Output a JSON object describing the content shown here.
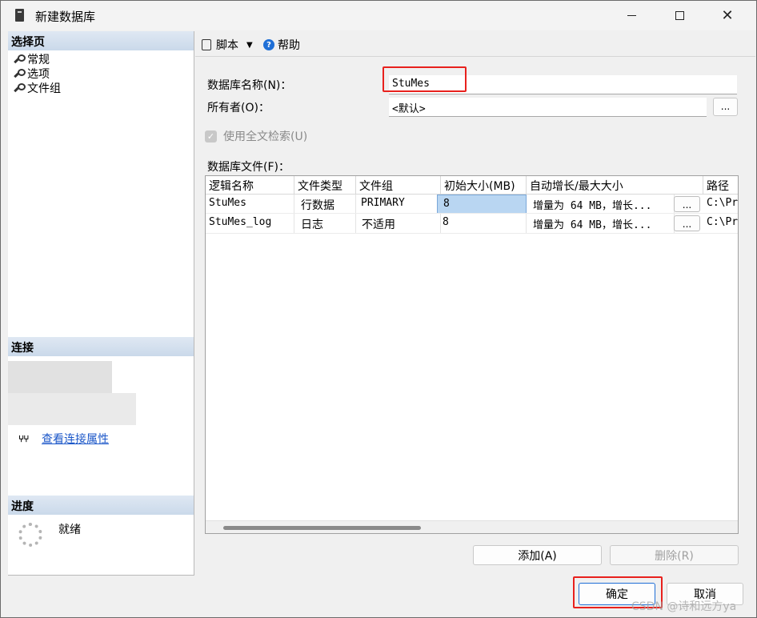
{
  "window": {
    "title": "新建数据库",
    "controls": [
      "minimize",
      "maximize",
      "close"
    ]
  },
  "left": {
    "select_page_header": "选择页",
    "pages": [
      {
        "label": "常规",
        "icon": "wrench-icon"
      },
      {
        "label": "选项",
        "icon": "wrench-icon"
      },
      {
        "label": "文件组",
        "icon": "wrench-icon"
      }
    ],
    "connection_header": "连接",
    "view_connection_properties": "查看连接属性",
    "progress_header": "进度",
    "progress_status": "就绪"
  },
  "toolbar": {
    "script_label": "脚本",
    "help_label": "帮助"
  },
  "form": {
    "db_name_label": "数据库名称(N)：",
    "db_name_value": "StuMes",
    "owner_label": "所有者(O)：",
    "owner_value": "<默认>",
    "owner_browse_label": "...",
    "fulltext_label": "使用全文检索(U)",
    "fulltext_checked": true,
    "files_label": "数据库文件(F)："
  },
  "grid": {
    "columns": [
      "逻辑名称",
      "文件类型",
      "文件组",
      "初始大小(MB)",
      "自动增长/最大大小",
      "路径"
    ],
    "rows": [
      {
        "logical_name": "StuMes",
        "file_type": "行数据",
        "filegroup": "PRIMARY",
        "initial_size": "8",
        "autogrowth": "增量为 64 MB，增长...",
        "path": "C:\\Pr",
        "browse": "..."
      },
      {
        "logical_name": "StuMes_log",
        "file_type": "日志",
        "filegroup": "不适用",
        "initial_size": "8",
        "autogrowth": "增量为 64 MB，增长...",
        "path": "C:\\Pr",
        "browse": "..."
      }
    ]
  },
  "buttons": {
    "add": "添加(A)",
    "remove": "删除(R)",
    "ok": "确定",
    "cancel": "取消"
  },
  "watermark": "CSDN @诗和远方ya",
  "colors": {
    "highlight_box": "#e8211d",
    "selected_cell": "#b9d6f2",
    "link": "#1a56c8",
    "section_header": "#cad9ea"
  }
}
